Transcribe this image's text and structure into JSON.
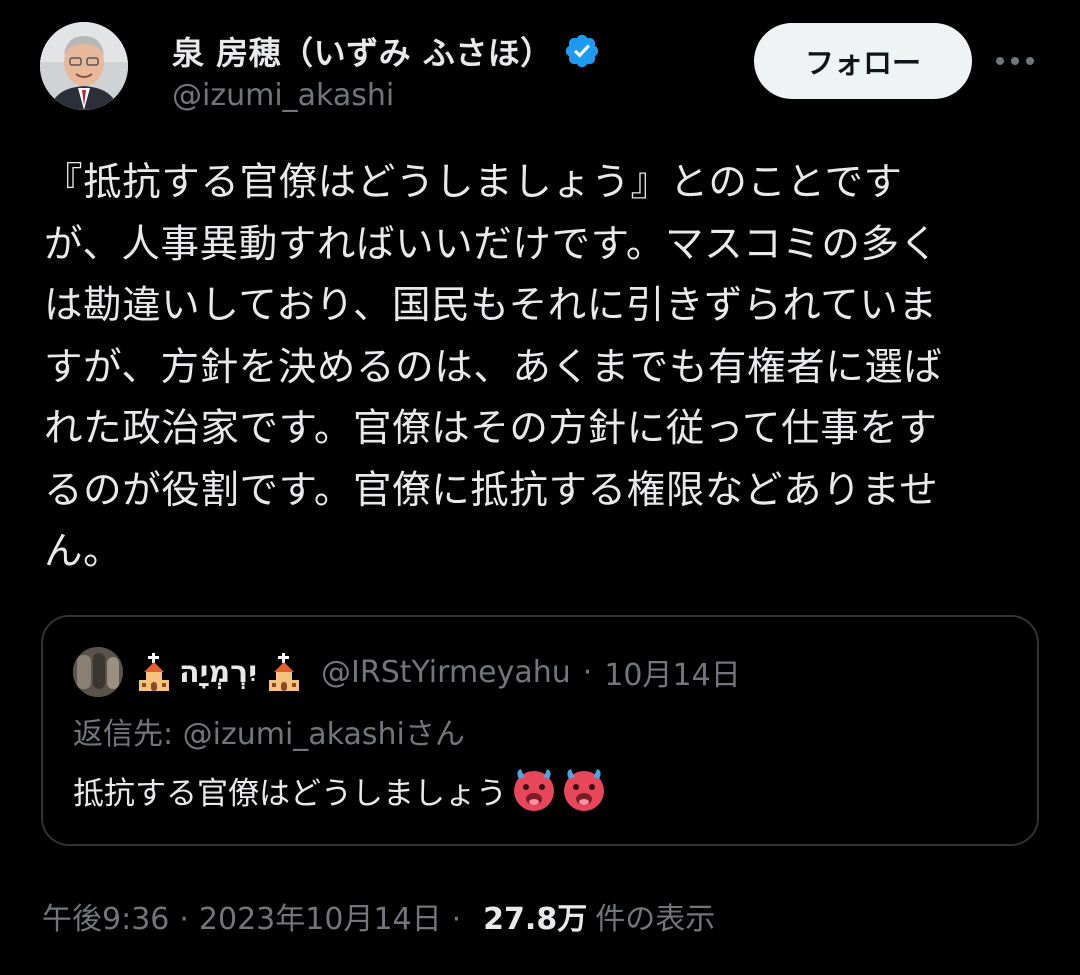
{
  "author": {
    "display_name": "泉 房穂（いずみ ふさほ）",
    "handle": "@izumi_akashi",
    "verified": true
  },
  "header": {
    "follow_label": "フォロー",
    "more_icon": "more-horizontal-icon"
  },
  "tweet": {
    "text": "『抵抗する官僚はどうしましょう』とのことです\nが、人事異動すればいいだけです。マスコミの多く\nは勘違いしており、国民もそれに引きずられていま\nすが、方針を決めるのは、あくまでも有権者に選ば\nれた政治家です。官僚はその方針に従って仕事をす\nるのが役割です。官僚に抵抗する権限などありませ\nん。"
  },
  "quote": {
    "display_name": "יִרְמְיָה",
    "handle": "@IRStYirmeyahu",
    "separator": "·",
    "date": "10月14日",
    "reply_to": "返信先: @izumi_akashiさん",
    "text": "抵抗する官僚はどうしましょう"
  },
  "meta": {
    "time": "午後9:36",
    "separator": "·",
    "date": "2023年10月14日",
    "views_count": "27.8万",
    "views_label": "件の表示"
  },
  "colors": {
    "background": "#000000",
    "text": "#e7e9ea",
    "secondary": "#71767b",
    "verified": "#1d9bf0",
    "border": "#2f3336",
    "follow_bg": "#eff3f4"
  }
}
